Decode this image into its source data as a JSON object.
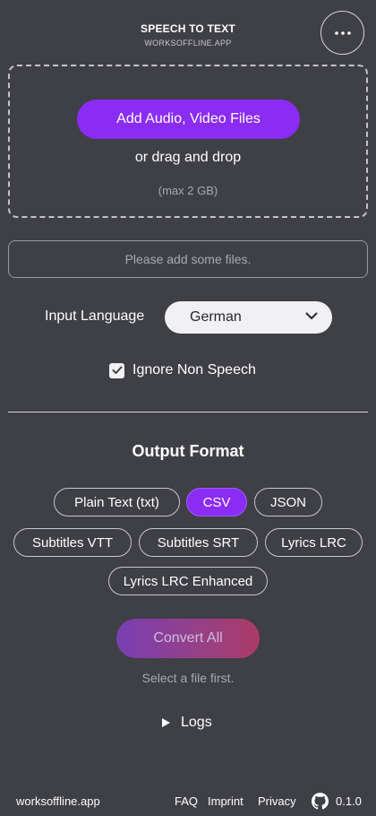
{
  "header": {
    "title": "SPEECH TO TEXT",
    "subtitle": "WORKSOFFLINE.APP",
    "menu_icon": "more-horizontal-icon"
  },
  "dropzone": {
    "add_button_label": "Add Audio, Video Files",
    "drag_text": "or drag and drop",
    "max_text": "(max 2 GB)"
  },
  "status": {
    "placeholder": "Please add some files."
  },
  "language": {
    "label": "Input Language",
    "selected": "German",
    "chevron_icon": "chevron-down-icon"
  },
  "options": {
    "ignore_non_speech_label": "Ignore Non Speech",
    "ignore_non_speech_checked": true
  },
  "output": {
    "title": "Output Format",
    "formats": [
      {
        "label": "Plain Text (txt)",
        "selected": false
      },
      {
        "label": "CSV",
        "selected": true
      },
      {
        "label": "JSON",
        "selected": false
      },
      {
        "label": "Subtitles VTT",
        "selected": false
      },
      {
        "label": "Subtitles SRT",
        "selected": false
      },
      {
        "label": "Lyrics LRC",
        "selected": false
      },
      {
        "label": "Lyrics LRC Enhanced",
        "selected": false
      }
    ]
  },
  "convert": {
    "label": "Convert All",
    "hint": "Select a file first."
  },
  "logs": {
    "label": "Logs"
  },
  "footer": {
    "brand": "worksoffline.app",
    "links": [
      "FAQ",
      "Imprint",
      "Privacy"
    ],
    "github_icon": "github-icon",
    "version": "0.1.0"
  },
  "colors": {
    "background": "#3f3f46",
    "accent": "#8b2cf5"
  }
}
